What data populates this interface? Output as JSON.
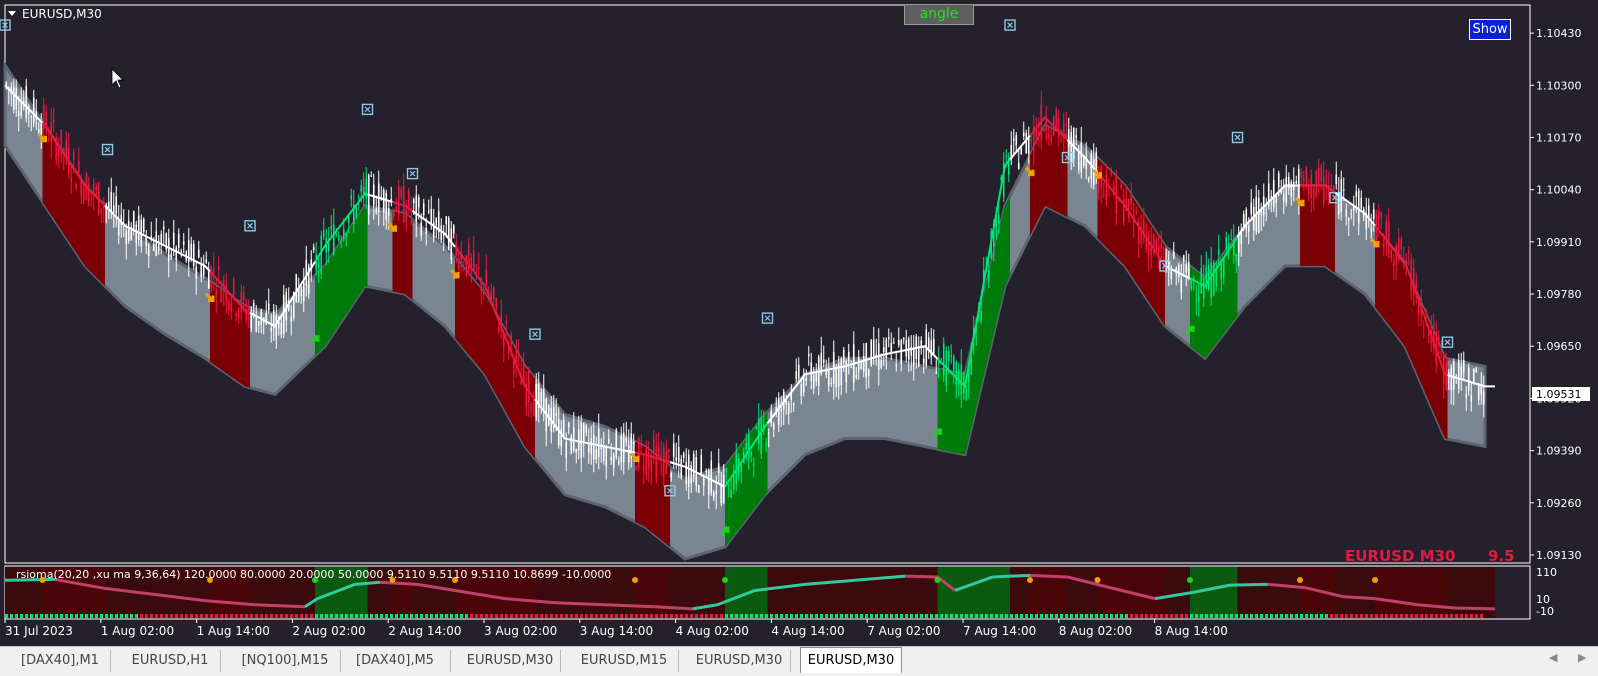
{
  "symbol_label": "EURUSD,M30",
  "buttons": {
    "angle": "angle",
    "show": "Show"
  },
  "watermark": {
    "symbol": "EURUSD M30",
    "value": "9.5"
  },
  "indicator_label": "rsioma(20,20 ,xu ma 9,36,64) 120.0000 80.0000 20.0000 50.0000 9.5110 9.5110 9.5110 10.8699 -10.0000",
  "current_price": "1.09531",
  "price_axis": {
    "labels": [
      "1.10430",
      "1.10300",
      "1.10170",
      "1.10040",
      "1.09910",
      "1.09780",
      "1.09650",
      "1.09520",
      "1.09390",
      "1.09260",
      "1.09130"
    ]
  },
  "sub_axis": {
    "labels": [
      "110",
      "10",
      "-10"
    ]
  },
  "time_axis": {
    "labels": [
      "31 Jul 2023",
      "1 Aug 02:00",
      "1 Aug 14:00",
      "2 Aug 02:00",
      "2 Aug 14:00",
      "3 Aug 02:00",
      "3 Aug 14:00",
      "4 Aug 02:00",
      "4 Aug 14:00",
      "7 Aug 02:00",
      "7 Aug 14:00",
      "8 Aug 02:00",
      "8 Aug 14:00"
    ]
  },
  "tabs": [
    {
      "label": "[DAX40],M1",
      "active": false
    },
    {
      "label": "EURUSD,H1",
      "active": false
    },
    {
      "label": "[NQ100],M15",
      "active": false
    },
    {
      "label": "[DAX40],M5",
      "active": false
    },
    {
      "label": "EURUSD,M30",
      "active": false
    },
    {
      "label": "EURUSD,M15",
      "active": false
    },
    {
      "label": "EURUSD,M30",
      "active": false
    },
    {
      "label": "EURUSD,M30",
      "active": true
    }
  ],
  "icons": {
    "tab_prev": "chevron-left-icon",
    "tab_next": "chevron-right-icon",
    "cursor": "mouse-pointer-icon",
    "collapse": "triangle-down-icon"
  },
  "colors": {
    "background": "#24212c",
    "band": "#7a8592",
    "up_segment": "#007a0a",
    "down_segment": "#7a0005",
    "bull_candle": "#00e676",
    "bear_candle": "#e8183f",
    "neutral_candle": "#ffffff",
    "arrow_up": "#20d020",
    "arrow_down": "#f0a000",
    "watermark": "#e8183f"
  },
  "chart_data": {
    "type": "candlestick",
    "x_tick_labels": [
      "31 Jul 2023",
      "1 Aug 02:00",
      "1 Aug 14:00",
      "2 Aug 02:00",
      "2 Aug 14:00",
      "3 Aug 02:00",
      "3 Aug 14:00",
      "4 Aug 02:00",
      "4 Aug 14:00",
      "7 Aug 02:00",
      "7 Aug 14:00",
      "8 Aug 02:00",
      "8 Aug 14:00"
    ],
    "y_tick_labels": [
      "1.10430",
      "1.10300",
      "1.10170",
      "1.10040",
      "1.09910",
      "1.09780",
      "1.09650",
      "1.09520",
      "1.09390",
      "1.09260",
      "1.09130"
    ],
    "ylim": [
      1.0911,
      1.105
    ],
    "ma_line": [
      [
        0,
        1.103
      ],
      [
        16,
        1.102
      ],
      [
        32,
        1.1005
      ],
      [
        48,
        1.0995
      ],
      [
        64,
        1.099
      ],
      [
        80,
        1.0985
      ],
      [
        96,
        1.0974
      ],
      [
        108,
        1.097
      ],
      [
        128,
        1.099
      ],
      [
        144,
        1.1003
      ],
      [
        160,
        1.1
      ],
      [
        176,
        1.0993
      ],
      [
        192,
        1.098
      ],
      [
        208,
        1.0955
      ],
      [
        224,
        1.0942
      ],
      [
        240,
        1.094
      ],
      [
        256,
        1.0938
      ],
      [
        272,
        1.0935
      ],
      [
        288,
        1.093
      ],
      [
        304,
        1.0945
      ],
      [
        320,
        1.0958
      ],
      [
        336,
        1.096
      ],
      [
        352,
        1.0963
      ],
      [
        368,
        1.0965
      ],
      [
        384,
        1.0955
      ],
      [
        400,
        1.101
      ],
      [
        416,
        1.1022
      ],
      [
        432,
        1.1012
      ],
      [
        448,
        1.1
      ],
      [
        464,
        1.0985
      ],
      [
        480,
        1.098
      ],
      [
        496,
        1.0995
      ],
      [
        512,
        1.1005
      ],
      [
        528,
        1.1005
      ],
      [
        544,
        1.0998
      ],
      [
        560,
        1.0986
      ],
      [
        576,
        1.0958
      ],
      [
        592,
        1.0955
      ]
    ],
    "band_mid": [
      [
        0,
        1.1025
      ],
      [
        16,
        1.101
      ],
      [
        32,
        1.0995
      ],
      [
        48,
        1.0985
      ],
      [
        64,
        1.0978
      ],
      [
        80,
        1.0972
      ],
      [
        96,
        1.0965
      ],
      [
        108,
        1.0963
      ],
      [
        128,
        1.0975
      ],
      [
        144,
        1.099
      ],
      [
        160,
        1.0988
      ],
      [
        176,
        1.098
      ],
      [
        192,
        1.0968
      ],
      [
        208,
        1.095
      ],
      [
        224,
        1.0938
      ],
      [
        240,
        1.0935
      ],
      [
        256,
        1.093
      ],
      [
        272,
        1.0922
      ],
      [
        288,
        1.0925
      ],
      [
        304,
        1.0938
      ],
      [
        320,
        1.0948
      ],
      [
        336,
        1.0952
      ],
      [
        352,
        1.0952
      ],
      [
        368,
        1.095
      ],
      [
        384,
        1.0948
      ],
      [
        400,
        1.099
      ],
      [
        416,
        1.101
      ],
      [
        432,
        1.1005
      ],
      [
        448,
        1.0995
      ],
      [
        464,
        1.098
      ],
      [
        480,
        1.0972
      ],
      [
        496,
        1.0985
      ],
      [
        512,
        1.0995
      ],
      [
        528,
        1.0995
      ],
      [
        544,
        1.0988
      ],
      [
        560,
        1.0975
      ],
      [
        576,
        1.0952
      ],
      [
        592,
        1.095
      ]
    ],
    "band_half_width": 0.001,
    "segments": [
      {
        "from": 0,
        "to": 15,
        "trend": "neutral"
      },
      {
        "from": 15,
        "to": 40,
        "trend": "down"
      },
      {
        "from": 40,
        "to": 82,
        "trend": "neutral"
      },
      {
        "from": 82,
        "to": 98,
        "trend": "down"
      },
      {
        "from": 98,
        "to": 124,
        "trend": "neutral"
      },
      {
        "from": 124,
        "to": 145,
        "trend": "up"
      },
      {
        "from": 145,
        "to": 155,
        "trend": "neutral"
      },
      {
        "from": 155,
        "to": 163,
        "trend": "down"
      },
      {
        "from": 163,
        "to": 180,
        "trend": "neutral"
      },
      {
        "from": 180,
        "to": 212,
        "trend": "down"
      },
      {
        "from": 212,
        "to": 252,
        "trend": "neutral"
      },
      {
        "from": 252,
        "to": 266,
        "trend": "down"
      },
      {
        "from": 266,
        "to": 288,
        "trend": "neutral"
      },
      {
        "from": 288,
        "to": 305,
        "trend": "up"
      },
      {
        "from": 305,
        "to": 373,
        "trend": "neutral"
      },
      {
        "from": 373,
        "to": 402,
        "trend": "up"
      },
      {
        "from": 402,
        "to": 410,
        "trend": "neutral"
      },
      {
        "from": 410,
        "to": 425,
        "trend": "down"
      },
      {
        "from": 425,
        "to": 437,
        "trend": "neutral"
      },
      {
        "from": 437,
        "to": 464,
        "trend": "down"
      },
      {
        "from": 464,
        "to": 474,
        "trend": "neutral"
      },
      {
        "from": 474,
        "to": 493,
        "trend": "up"
      },
      {
        "from": 493,
        "to": 518,
        "trend": "neutral"
      },
      {
        "from": 518,
        "to": 532,
        "trend": "down"
      },
      {
        "from": 532,
        "to": 548,
        "trend": "neutral"
      },
      {
        "from": 548,
        "to": 577,
        "trend": "down"
      },
      {
        "from": 577,
        "to": 596,
        "trend": "neutral"
      }
    ],
    "signal_arrows": [
      {
        "bar": 15,
        "dir": "down"
      },
      {
        "bar": 82,
        "dir": "down"
      },
      {
        "bar": 124,
        "dir": "up"
      },
      {
        "bar": 155,
        "dir": "down"
      },
      {
        "bar": 180,
        "dir": "down"
      },
      {
        "bar": 252,
        "dir": "down"
      },
      {
        "bar": 288,
        "dir": "up"
      },
      {
        "bar": 373,
        "dir": "up"
      },
      {
        "bar": 410,
        "dir": "down"
      },
      {
        "bar": 437,
        "dir": "down"
      },
      {
        "bar": 474,
        "dir": "up"
      },
      {
        "bar": 518,
        "dir": "down"
      },
      {
        "bar": 548,
        "dir": "down"
      }
    ],
    "exit_markers": [
      {
        "bar": 0,
        "price": 1.1045
      },
      {
        "bar": 41,
        "price": 1.1014
      },
      {
        "bar": 98,
        "price": 1.0995
      },
      {
        "bar": 145,
        "price": 1.1024
      },
      {
        "bar": 163,
        "price": 1.1008
      },
      {
        "bar": 212,
        "price": 1.0968
      },
      {
        "bar": 266,
        "price": 1.0929
      },
      {
        "bar": 305,
        "price": 1.0972
      },
      {
        "bar": 402,
        "price": 1.1045
      },
      {
        "bar": 425,
        "price": 1.1012
      },
      {
        "bar": 464,
        "price": 1.0985
      },
      {
        "bar": 493,
        "price": 1.1017
      },
      {
        "bar": 532,
        "price": 1.1002
      },
      {
        "bar": 577,
        "price": 1.0966
      }
    ],
    "oscillator": {
      "levels": [
        110,
        10,
        -10
      ],
      "line": [
        [
          0,
          80
        ],
        [
          20,
          82
        ],
        [
          40,
          60
        ],
        [
          60,
          45
        ],
        [
          80,
          30
        ],
        [
          100,
          20
        ],
        [
          120,
          15
        ],
        [
          125,
          35
        ],
        [
          140,
          70
        ],
        [
          150,
          75
        ],
        [
          165,
          70
        ],
        [
          180,
          55
        ],
        [
          200,
          35
        ],
        [
          220,
          25
        ],
        [
          240,
          20
        ],
        [
          260,
          15
        ],
        [
          275,
          10
        ],
        [
          285,
          20
        ],
        [
          300,
          55
        ],
        [
          320,
          70
        ],
        [
          340,
          80
        ],
        [
          360,
          90
        ],
        [
          373,
          88
        ],
        [
          380,
          55
        ],
        [
          395,
          88
        ],
        [
          410,
          92
        ],
        [
          425,
          88
        ],
        [
          440,
          65
        ],
        [
          460,
          35
        ],
        [
          475,
          50
        ],
        [
          490,
          68
        ],
        [
          505,
          70
        ],
        [
          520,
          62
        ],
        [
          535,
          40
        ],
        [
          548,
          35
        ],
        [
          565,
          20
        ],
        [
          580,
          12
        ],
        [
          596,
          10
        ]
      ]
    }
  }
}
